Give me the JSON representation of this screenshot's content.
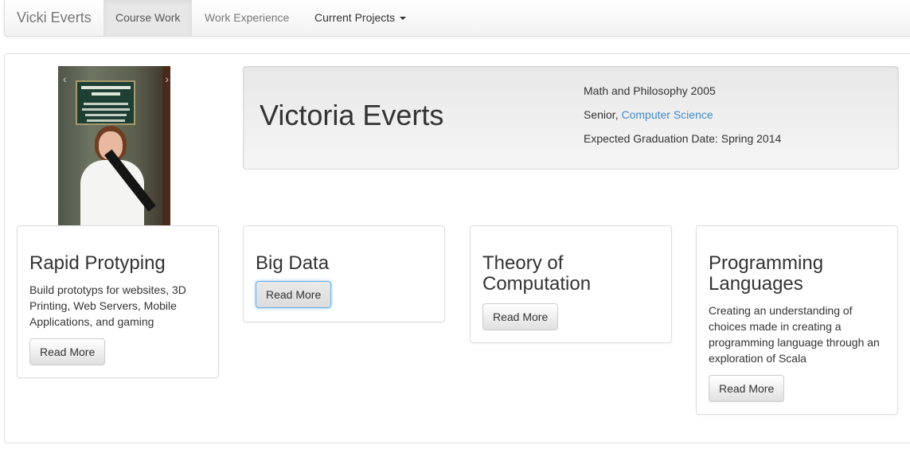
{
  "navbar": {
    "brand": "Vicki Everts",
    "items": [
      {
        "label": "Course Work"
      },
      {
        "label": "Work Experience"
      },
      {
        "label": "Current Projects"
      }
    ]
  },
  "profile": {
    "name": "Victoria Everts",
    "line1": "Math and Philosophy 2005",
    "line2_prefix": "Senior, ",
    "line2_link": "Computer Science",
    "line3": "Expected Graduation Date: Spring 2014"
  },
  "cards": [
    {
      "title": "Rapid Protyping",
      "text": "Build prototyps for websites, 3D Printing, Web Servers, Mobile Applications, and gaming",
      "button": "Read More"
    },
    {
      "title": "Big Data",
      "text": "",
      "button": "Read More"
    },
    {
      "title": "Theory of Computation",
      "text": "",
      "button": "Read More"
    },
    {
      "title": "Programming Languages",
      "text": "Creating an understanding of choices made in creating a programming language through an exploration of Scala",
      "button": "Read More"
    }
  ],
  "colors": {
    "link": "#428bca",
    "navbar_active_bg": "#e7e7e7",
    "jumbotron_bg": "#eeeeee"
  },
  "icons": {
    "dropdown": "caret-down-icon"
  }
}
